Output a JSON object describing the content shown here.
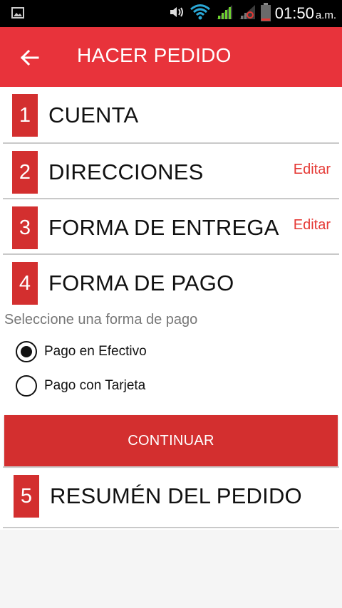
{
  "status_bar": {
    "time": "01:50",
    "ampm": "a.m.",
    "icons": [
      "image-icon",
      "vibrate-icon",
      "wifi-icon",
      "signal-icon",
      "signal-alt-icon",
      "battery-icon"
    ]
  },
  "app_bar": {
    "title": "HACER PEDIDO",
    "back_icon": "arrow-back-icon"
  },
  "steps": [
    {
      "number": "1",
      "label": "CUENTA",
      "edit": ""
    },
    {
      "number": "2",
      "label": "DIRECCIONES",
      "edit": "Editar"
    },
    {
      "number": "3",
      "label": "FORMA DE ENTREGA",
      "edit": "Editar"
    },
    {
      "number": "4",
      "label": "FORMA DE PAGO",
      "edit": ""
    },
    {
      "number": "5",
      "label": "RESUMÉN DEL PEDIDO",
      "edit": ""
    }
  ],
  "payment": {
    "hint": "Seleccione una forma de pago",
    "options": [
      {
        "label": "Pago en Efectivo",
        "selected": true
      },
      {
        "label": "Pago con Tarjeta",
        "selected": false
      }
    ],
    "continue_label": "CONTINUAR"
  },
  "colors": {
    "primary": "#e8333b",
    "accent": "#d32f2f",
    "link": "#e53935"
  }
}
